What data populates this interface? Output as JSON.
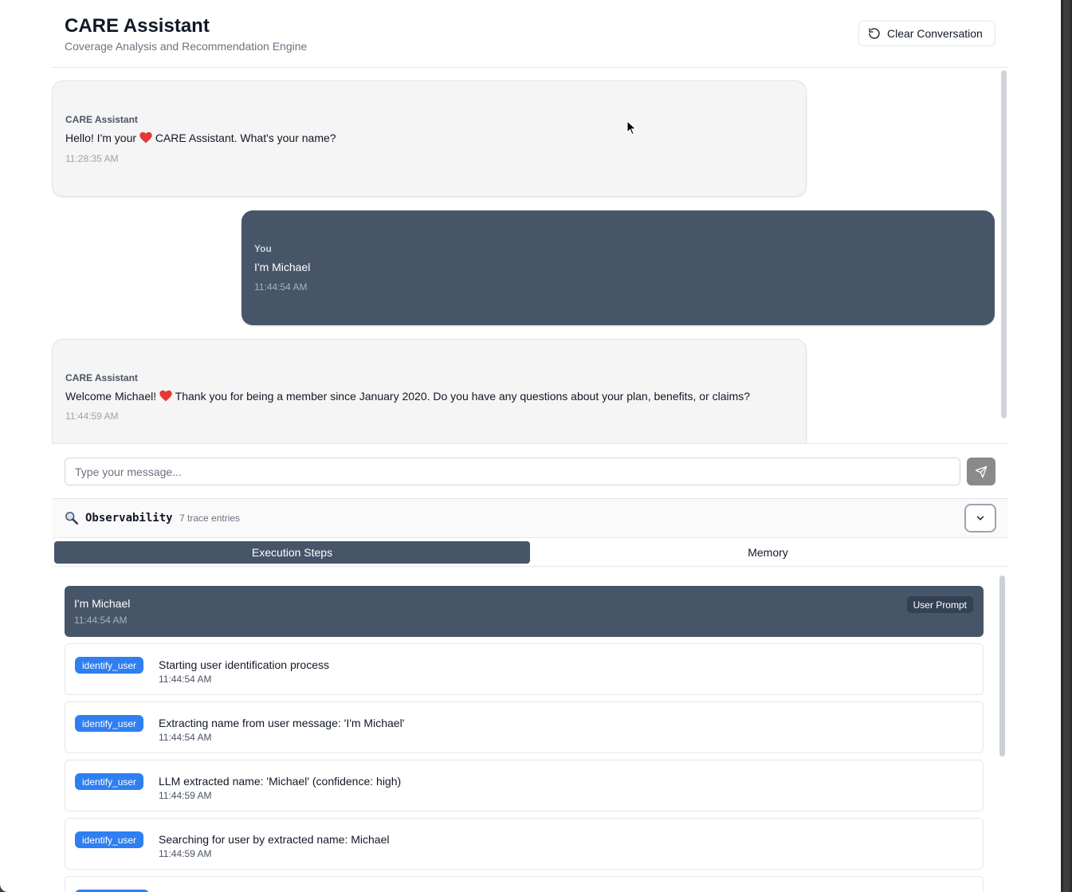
{
  "header": {
    "title": "CARE Assistant",
    "subtitle": "Coverage Analysis and Recommendation Engine",
    "clear_label": "Clear Conversation"
  },
  "messages": [
    {
      "role": "assistant",
      "sender": "CARE Assistant",
      "text_before": "Hello! I'm your",
      "text_after": "CARE Assistant. What's your name?",
      "time": "11:28:35 AM"
    },
    {
      "role": "user",
      "sender": "You",
      "text": "I'm Michael",
      "time": "11:44:54 AM"
    },
    {
      "role": "assistant",
      "sender": "CARE Assistant",
      "text_before": "Welcome Michael!",
      "text_after": "Thank you for being a member since January 2020. Do you have any questions about your plan, benefits, or claims?",
      "time": "11:44:59 AM"
    }
  ],
  "input": {
    "placeholder": "Type your message..."
  },
  "observability": {
    "title": "Observability",
    "count": "7 trace entries",
    "tabs": [
      "Execution Steps",
      "Memory"
    ],
    "active_tab": "Execution Steps"
  },
  "steps": {
    "prompt": {
      "text": "I'm Michael",
      "time": "11:44:54 AM",
      "badge": "User Prompt"
    },
    "items": [
      {
        "badge": "identify_user",
        "text": "Starting user identification process",
        "time": "11:44:54 AM"
      },
      {
        "badge": "identify_user",
        "text": "Extracting name from user message: 'I'm Michael'",
        "time": "11:44:54 AM"
      },
      {
        "badge": "identify_user",
        "text": "LLM extracted name: 'Michael' (confidence: high)",
        "time": "11:44:59 AM"
      },
      {
        "badge": "identify_user",
        "text": "Searching for user by extracted name: Michael",
        "time": "11:44:59 AM"
      }
    ]
  },
  "colors": {
    "accent": "#475569",
    "step_badge": "#2f7ff0",
    "heart": "#e53935"
  }
}
